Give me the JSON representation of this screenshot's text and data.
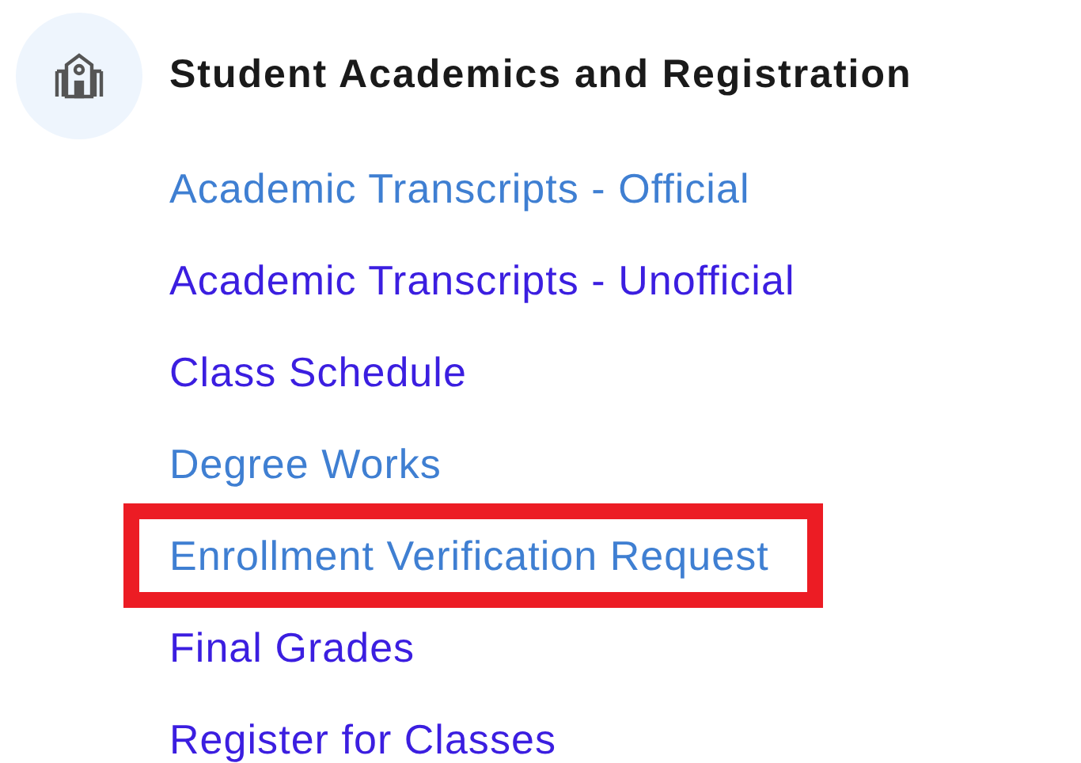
{
  "section": {
    "title": "Student Academics and Registration"
  },
  "links": [
    {
      "label": "Academic Transcripts - Official",
      "visited": false,
      "highlighted": false
    },
    {
      "label": "Academic Transcripts - Unofficial",
      "visited": true,
      "highlighted": false
    },
    {
      "label": "Class Schedule",
      "visited": true,
      "highlighted": false
    },
    {
      "label": "Degree Works",
      "visited": false,
      "highlighted": false
    },
    {
      "label": "Enrollment Verification Request",
      "visited": false,
      "highlighted": true
    },
    {
      "label": "Final Grades",
      "visited": true,
      "highlighted": false
    },
    {
      "label": "Register for Classes",
      "visited": true,
      "highlighted": false
    }
  ]
}
